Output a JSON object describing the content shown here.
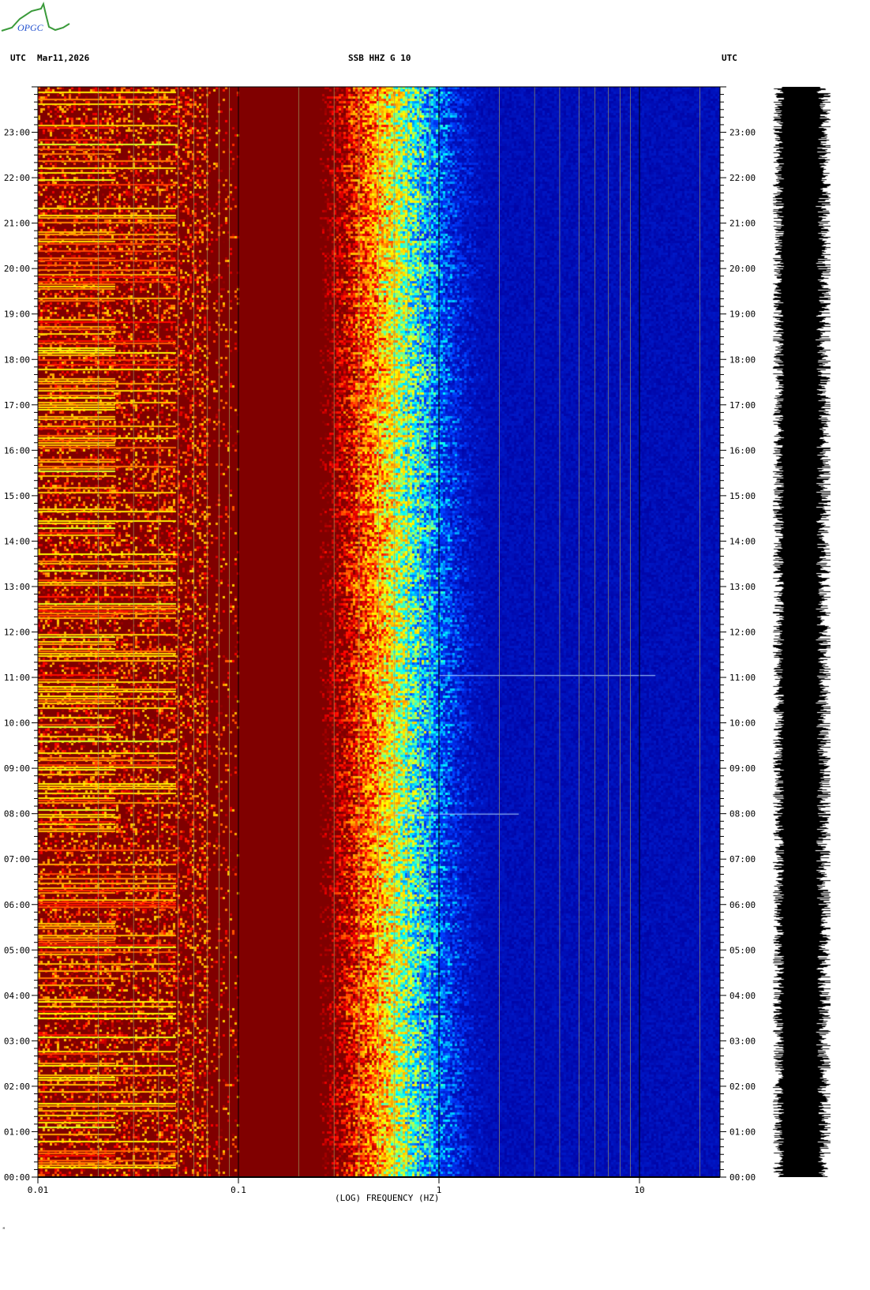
{
  "header": {
    "left_zone": "UTC",
    "date": "Mar11,2026",
    "station": "SSB HHZ G 10",
    "right_zone": "UTC"
  },
  "logo": {
    "text": "OPGC"
  },
  "footer_mark": "ᴹ",
  "colors": {
    "background_low": "#0000a0",
    "high": "#800000",
    "red": "#ff0000",
    "yellow": "#ffff00",
    "cyan": "#00ffff",
    "grid": "#a0a0a0"
  },
  "chart_data": {
    "type": "heatmap",
    "title": "SSB HHZ G 10",
    "xlabel": "(LOG) FREQUENCY (HZ)",
    "ylabel": "UTC",
    "xscale": "log",
    "xlim": [
      0.01,
      25
    ],
    "ylim_hours": [
      0,
      24
    ],
    "x_ticks": [
      "0.01",
      "0.1",
      "1",
      "10"
    ],
    "y_ticks": [
      "00:00",
      "01:00",
      "02:00",
      "03:00",
      "04:00",
      "05:00",
      "06:00",
      "07:00",
      "08:00",
      "09:00",
      "10:00",
      "11:00",
      "12:00",
      "13:00",
      "14:00",
      "15:00",
      "16:00",
      "17:00",
      "18:00",
      "19:00",
      "20:00",
      "21:00",
      "22:00",
      "23:00"
    ],
    "microseism_peak_hz": [
      0.25,
      0.7
    ],
    "events": [
      {
        "time_hours": 11.05,
        "freq_range_hz": [
          1,
          12
        ]
      },
      {
        "time_hours": 8.0,
        "freq_range_hz": [
          0.6,
          2.5
        ]
      }
    ]
  }
}
